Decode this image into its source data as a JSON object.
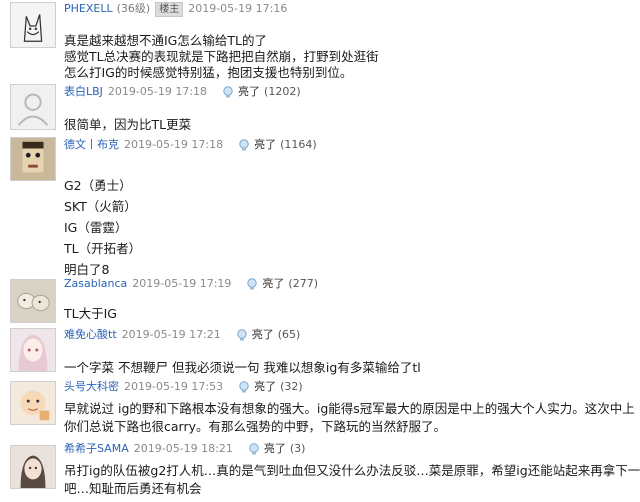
{
  "comments": [
    {
      "user": "PHEXELL",
      "level": "(36级)",
      "badge": "楼主",
      "time": "2019-05-19 17:16",
      "lines": [
        "真是越来越想不通IG怎么输给TL的了",
        "感觉TL总决赛的表现就是下路把把自然崩，打野到处逛街",
        "怎么打IG的时候感觉特别猛，抱团支援也特别到位。"
      ]
    },
    {
      "user": "表白LBJ",
      "time": "2019-05-19 17:18",
      "like_label": "亮了",
      "count": "(1202)",
      "lines": [
        "很简单，因为比TL更菜"
      ]
    },
    {
      "user": "德文丨布克",
      "time": "2019-05-19 17:18",
      "like_label": "亮了",
      "count": "(1164)",
      "lines": [
        "G2（勇士）",
        "SKT（火箭）",
        "IG（雷霆）",
        "TL（开拓者）",
        "明白了8"
      ]
    },
    {
      "user": "Zasablanca",
      "time": "2019-05-19 17:19",
      "like_label": "亮了",
      "count": "(277)",
      "lines": [
        "TL大于IG"
      ]
    },
    {
      "user": "难免心酸tt",
      "time": "2019-05-19 17:21",
      "like_label": "亮了",
      "count": "(65)",
      "lines": [
        "一个字菜 不想鞭尸 但我必须说一句 我难以想象ig有多菜输给了tl"
      ]
    },
    {
      "user": "头号大科密",
      "time": "2019-05-19 17:53",
      "like_label": "亮了",
      "count": "(32)",
      "lines": [
        "早就说过 ig的野和下路根本没有想象的强大。ig能得s冠军最大的原因是中上的强大个人实力。这次中上",
        "你们总说下路也很carry。有那么强势的中野，下路玩的当然舒服了。"
      ]
    },
    {
      "user": "希希子SAMA",
      "time": "2019-05-19 18:21",
      "like_label": "亮了",
      "count": "(3)",
      "lines": [
        "吊打ig的队伍被g2打人机…真的是气到吐血但又没什么办法反驳…菜是原罪，希望ig还能站起来再拿下一",
        "吧…知耻而后勇还有机会"
      ]
    }
  ]
}
